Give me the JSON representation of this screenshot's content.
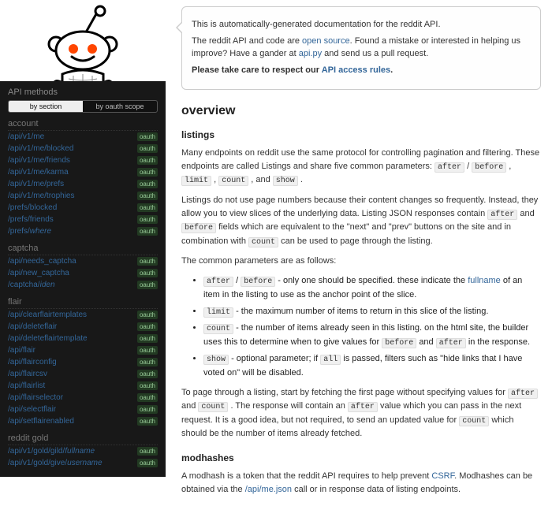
{
  "sidebar": {
    "title": "API methods",
    "toggle": {
      "active": "by section",
      "inactive": "by oauth scope"
    },
    "oauth_label": "oauth",
    "sections": [
      {
        "name": "account",
        "items": [
          {
            "path": "/api/v1/me",
            "oauth": true
          },
          {
            "path": "/api/v1/me/blocked",
            "oauth": true
          },
          {
            "path": "/api/v1/me/friends",
            "oauth": true
          },
          {
            "path": "/api/v1/me/karma",
            "oauth": true
          },
          {
            "path": "/api/v1/me/prefs",
            "oauth": true
          },
          {
            "path": "/api/v1/me/trophies",
            "oauth": true
          },
          {
            "path": "/prefs/blocked",
            "oauth": true
          },
          {
            "path": "/prefs/friends",
            "oauth": true
          },
          {
            "path": "/prefs/where",
            "oauth": true,
            "italic_last": true
          }
        ]
      },
      {
        "name": "captcha",
        "items": [
          {
            "path": "/api/needs_captcha",
            "oauth": true
          },
          {
            "path": "/api/new_captcha",
            "oauth": true
          },
          {
            "path": "/captcha/iden",
            "oauth": true,
            "italic_last": true
          }
        ]
      },
      {
        "name": "flair",
        "items": [
          {
            "path": "/api/clearflairtemplates",
            "oauth": true
          },
          {
            "path": "/api/deleteflair",
            "oauth": true
          },
          {
            "path": "/api/deleteflairtemplate",
            "oauth": true
          },
          {
            "path": "/api/flair",
            "oauth": true
          },
          {
            "path": "/api/flairconfig",
            "oauth": true
          },
          {
            "path": "/api/flaircsv",
            "oauth": true
          },
          {
            "path": "/api/flairlist",
            "oauth": true
          },
          {
            "path": "/api/flairselector",
            "oauth": true
          },
          {
            "path": "/api/selectflair",
            "oauth": true
          },
          {
            "path": "/api/setflairenabled",
            "oauth": true
          }
        ]
      },
      {
        "name": "reddit gold",
        "items": [
          {
            "path": "/api/v1/gold/gild/fullname",
            "oauth": true,
            "italic_last": true
          },
          {
            "path": "/api/v1/gold/give/username",
            "oauth": true,
            "italic_last": true
          }
        ]
      }
    ]
  },
  "info": {
    "p1": "This is automatically-generated documentation for the reddit API.",
    "p2a": "The reddit API and code are ",
    "p2link1": "open source",
    "p2b": ". Found a mistake or interested in helping us improve? Have a gander at ",
    "p2link2": "api.py",
    "p2c": " and send us a pull request.",
    "p3a": "Please take care to respect our ",
    "p3link": "API access rules",
    "p3b": "."
  },
  "content": {
    "heading": "overview",
    "listings": {
      "heading": "listings",
      "p1a": "Many endpoints on reddit use the same protocol for controlling pagination and filtering. These endpoints are called Listings and share five common parameters: ",
      "tok_after": "after",
      "sep_slash": " / ",
      "tok_before": "before",
      "sep_comma1": " , ",
      "tok_limit": "limit",
      "sep_comma2": " , ",
      "tok_count": "count",
      "sep_and": " , and ",
      "tok_show": "show",
      "period": " .",
      "p2a": "Listings do not use page numbers because their content changes so frequently. Instead, they allow you to view slices of the underlying data. Listing JSON responses contain ",
      "p2b": " and ",
      "p2c": " fields which are equivalent to the \"next\" and \"prev\" buttons on the site and in combination with ",
      "p2d": " can be used to page through the listing.",
      "p3": "The common parameters are as follows:",
      "bullets": {
        "b1a": " - only one should be specified. these indicate the ",
        "b1link": "fullname",
        "b1b": " of an item in the listing to use as the anchor point of the slice.",
        "b2": " - the maximum number of items to return in this slice of the listing.",
        "b3a": " - the number of items already seen in this listing. on the html site, the builder uses this to determine when to give values for ",
        "b3b": " and ",
        "b3c": " in the response.",
        "b4a": " - optional parameter; if ",
        "tok_all": "all",
        "b4b": " is passed, filters such as \"hide links that I have voted on\" will be disabled."
      },
      "p4a": "To page through a listing, start by fetching the first page without specifying values for ",
      "p4b": " and ",
      "p4c": " . The response will contain an ",
      "p4d": " value which you can pass in the next request. It is a good idea, but not required, to send an updated value for ",
      "p4e": " which should be the number of items already fetched."
    },
    "modhashes": {
      "heading": "modhashes",
      "p1a": "A modhash is a token that the reddit API requires to help prevent ",
      "link_csrf": "CSRF",
      "p1b": ". Modhashes can be obtained via the ",
      "link_me": "/api/me.json",
      "p1c": " call or in response data of listing endpoints."
    }
  }
}
